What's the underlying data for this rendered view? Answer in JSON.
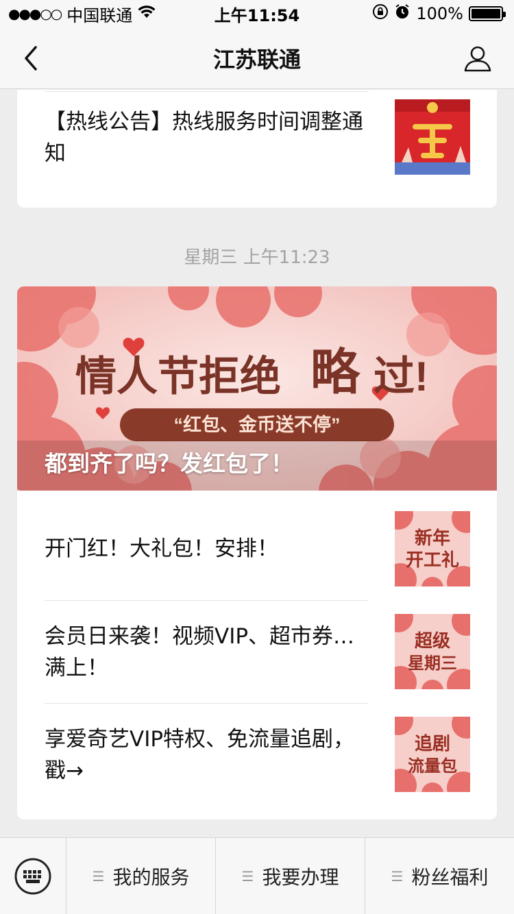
{
  "status_bar": {
    "signal": "●●●○○",
    "carrier": "中国联通",
    "time": "上午11:54",
    "battery": "100%"
  },
  "nav": {
    "title": "江苏联通"
  },
  "articles_top": [
    {
      "title": "【热线公告】热线服务时间调整通知",
      "thumb_text": ""
    }
  ],
  "timestamp": "星期三 上午11:23",
  "banner": {
    "headline_main": "情人节拒绝",
    "headline_quote": "略",
    "headline_end": "过!",
    "subline": "“红包、金币送不停”",
    "caption": "都到齐了吗？发红包了！"
  },
  "articles": [
    {
      "title": "开门红！大礼包！安排！",
      "thumb_line1": "新年",
      "thumb_line2": "开工礼"
    },
    {
      "title": "会员日来袭！视频VIP、超市券…满上！",
      "thumb_line1": "超级",
      "thumb_line2": "星期三"
    },
    {
      "title": "享爱奇艺VIP特权、免流量追剧，戳→",
      "thumb_line1": "追剧",
      "thumb_line2": "流量包"
    }
  ],
  "bottom_menu": [
    {
      "label": "我的服务"
    },
    {
      "label": "我要办理"
    },
    {
      "label": "粉丝福利"
    }
  ],
  "colors": {
    "accent_red": "#d9534f",
    "banner_pink": "#f4c6c3",
    "headline_brown": "#7a3326"
  }
}
